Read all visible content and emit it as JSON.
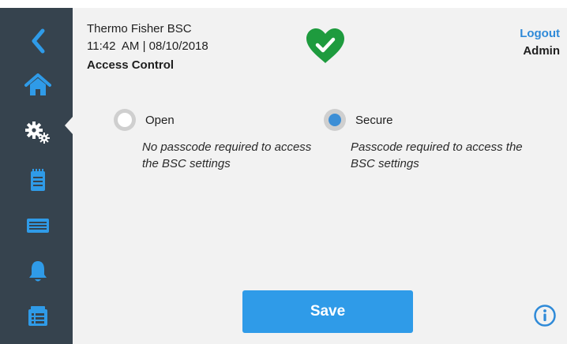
{
  "colors": {
    "sidebar_bg": "#36434e",
    "content_bg": "#f2f2f2",
    "accent_blue": "#2f8ad8",
    "nav_icon_blue": "#2f9be8",
    "status_green": "#1e9b3e",
    "save_button": "#2f9be8"
  },
  "sidebar": {
    "items": [
      {
        "name": "back",
        "icon": "chevron-left-icon"
      },
      {
        "name": "home",
        "icon": "home-icon"
      },
      {
        "name": "settings",
        "icon": "gears-icon",
        "active": true
      },
      {
        "name": "log",
        "icon": "notepad-icon"
      },
      {
        "name": "display",
        "icon": "display-panel-icon"
      },
      {
        "name": "alarms",
        "icon": "bell-icon"
      },
      {
        "name": "reports",
        "icon": "report-list-icon"
      }
    ]
  },
  "header": {
    "device_name": "Thermo Fisher BSC",
    "datetime": "11:42  AM | 08/10/2018",
    "page_title": "Access Control",
    "status_icon": "heart-check-icon",
    "logout_label": "Logout",
    "user_role": "Admin"
  },
  "access": {
    "selected": "secure",
    "options": [
      {
        "id": "open",
        "label": "Open",
        "description": "No passcode required to access the BSC settings"
      },
      {
        "id": "secure",
        "label": "Secure",
        "description": "Passcode required to access the BSC settings"
      }
    ]
  },
  "footer": {
    "save_label": "Save",
    "info_icon": "info-icon"
  }
}
